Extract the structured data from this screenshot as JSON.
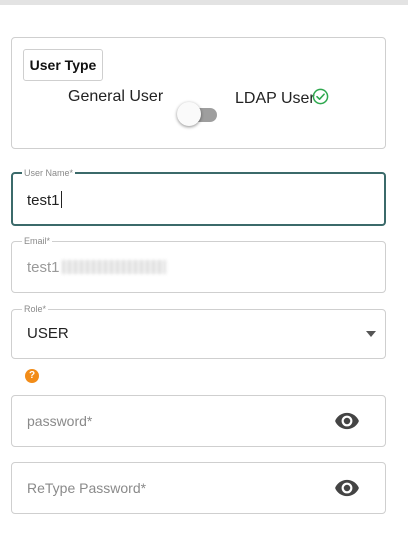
{
  "user_type": {
    "title": "User Type",
    "option_general": "General User",
    "option_ldap": "LDAP User",
    "toggle_on": false,
    "check_icon": "check-circle-icon",
    "check_color": "#2fa84f"
  },
  "fields": {
    "username": {
      "label": "User Name*",
      "value": "test1"
    },
    "email": {
      "label": "Email*",
      "value": "test1"
    },
    "role": {
      "label": "Role*",
      "value": "USER"
    },
    "password": {
      "placeholder": "password*",
      "icon": "eye-icon"
    },
    "retype_password": {
      "placeholder": "ReType Password*",
      "icon": "eye-icon"
    }
  },
  "help": {
    "icon": "question-icon",
    "glyph": "?",
    "color": "#f28c18"
  },
  "colors": {
    "focus_border": "#3b6a6a",
    "border": "#cfcfcf"
  }
}
